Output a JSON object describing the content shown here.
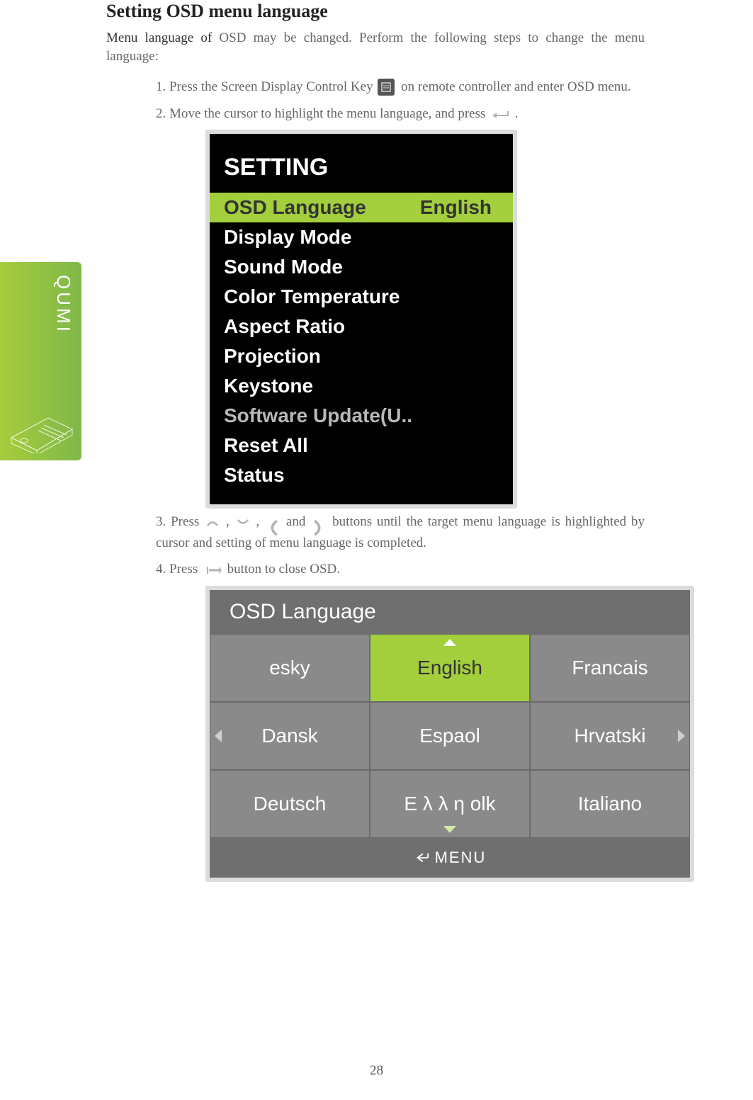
{
  "side_tab_text": "QUMI",
  "title": "Setting OSD menu language",
  "intro_lead": "Menu language of",
  "intro_rest": " OSD may be changed. Perform the following steps to change the menu language:",
  "step1_a": "1. Press the Screen Display Control Key",
  "step1_b": "  on remote controller and enter OSD menu.",
  "step2_a": "2. Move the cursor to highlight the menu language, and press",
  "step2_b": ".",
  "osd1": {
    "title": "SETTING",
    "sel_label": "OSD Language",
    "sel_value": "English",
    "items": [
      "Display Mode",
      "Sound Mode",
      "Color Temperature",
      "Aspect Ratio",
      "Projection",
      "Keystone",
      "Software Update(U..",
      "Reset All",
      "Status"
    ]
  },
  "step3_a": "3. Press",
  "step3_b": ",   ",
  "step3_c": ",   ",
  "step3_d": " and ",
  "step3_e": " buttons until the target menu language is highlighted by cursor and setting of menu language is completed.",
  "step4_a": "4. Press   ",
  "step4_b": "button to close OSD.",
  "osd2": {
    "header": "OSD Language",
    "cells": [
      [
        "esky",
        "English",
        "Francais"
      ],
      [
        "Dansk",
        "Espaol",
        "Hrvatski"
      ],
      [
        "Deutsch",
        "Ε λ  λ   η olk",
        "Italiano"
      ]
    ],
    "footer": "MENU"
  },
  "page_number": "28"
}
